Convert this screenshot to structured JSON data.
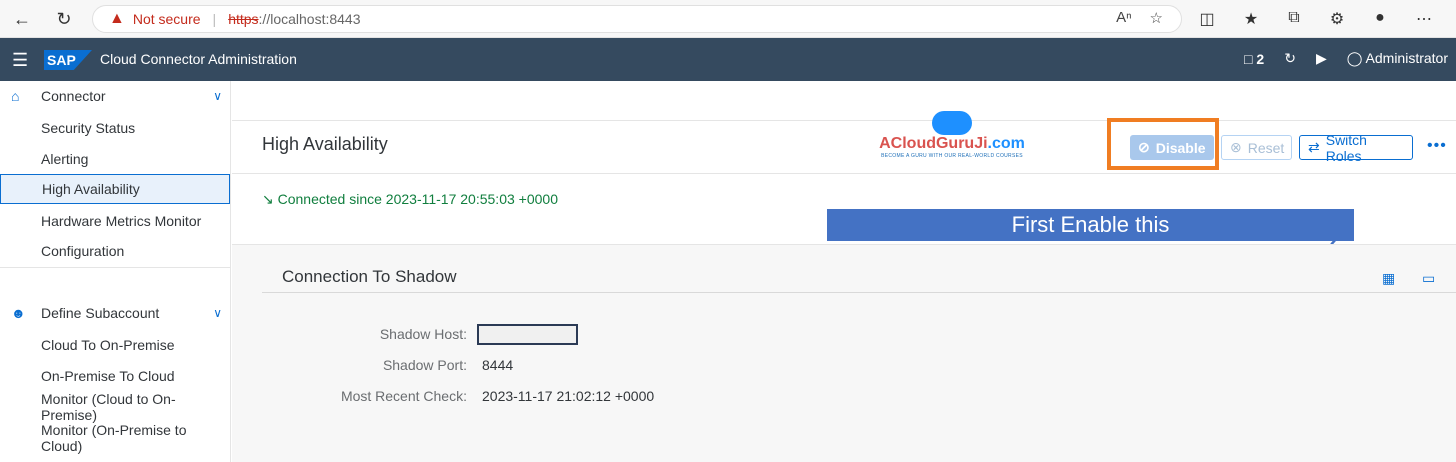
{
  "browser": {
    "not_secure": "Not secure",
    "url_scheme": "https",
    "url_rest": "://localhost:8443"
  },
  "shell": {
    "logo": "SAP",
    "title": "Cloud Connector Administration",
    "notifications": "2",
    "user": "Administrator"
  },
  "sidebar": {
    "connector": "Connector",
    "items": [
      "Security Status",
      "Alerting",
      "High Availability",
      "Hardware Metrics Monitor",
      "Configuration"
    ],
    "define_subaccount": "Define Subaccount",
    "sub_items": [
      "Cloud To On-Premise",
      "On-Premise To Cloud",
      "Monitor (Cloud to On-Premise)",
      "Monitor (On-Premise to Cloud)"
    ]
  },
  "main": {
    "page_title": "High Availability",
    "watermark_name": "ACloudGuruJi",
    "watermark_com": ".com",
    "watermark_tagline": "BECOME A GURU WITH OUR REAL-WORLD COURSES",
    "disable_label": "Disable",
    "reset_label": "Reset",
    "switch_roles_label": "Switch Roles",
    "status": "Connected since 2023-11-17 20:55:03 +0000",
    "callout": "First Enable this",
    "section_title": "Connection To Shadow",
    "shadow_host_label": "Shadow Host:",
    "shadow_port_label": "Shadow Port:",
    "shadow_port_value": "8444",
    "recent_check_label": "Most Recent Check:",
    "recent_check_value": "2023-11-17 21:02:12 +0000"
  }
}
